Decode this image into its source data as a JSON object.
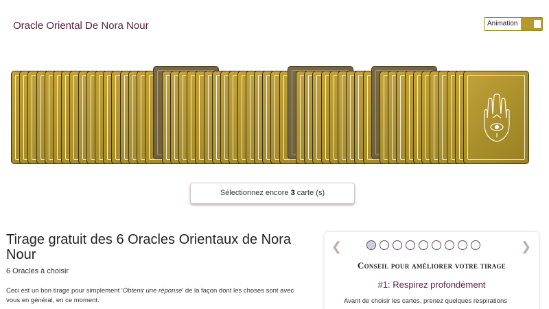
{
  "header": {
    "title": "Oracle Oriental De Nora Nour"
  },
  "animation_toggle": {
    "label": "Animation",
    "on": true
  },
  "deck": {
    "card_count": 55,
    "selected_indices": [
      17,
      33,
      43
    ]
  },
  "selection": {
    "prefix": "Sélectionnez encore ",
    "count": "3",
    "suffix": " carte (s)"
  },
  "intro": {
    "heading": "Tirage gratuit des 6 Oracles Orientaux de Nora Nour",
    "subheading": "6 Oracles à choisir",
    "text_before": "Ceci est un bon tirage pour simplement '",
    "text_italic": "Obtenir une réponse",
    "text_after": "' de la façon dont les choses sont avec vous en général, en ce moment."
  },
  "tips_panel": {
    "title": "Conseil pour améliorer votre tirage",
    "tip_title": "#1: Respirez profondément",
    "tip_text": "Avant de choisir les cartes, prenez quelques respirations",
    "dots_total": 9,
    "active_dot": 0,
    "prev_icon": "chevron-left-icon",
    "next_icon": "chevron-right-icon"
  },
  "colors": {
    "brand": "#5a1f3a",
    "card_gold": "#b39a2a",
    "card_selected": "#6f6140"
  }
}
